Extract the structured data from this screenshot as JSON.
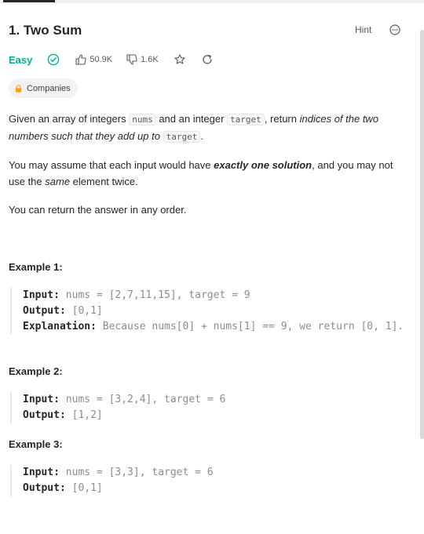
{
  "problem": {
    "title": "1. Two Sum",
    "hint_label": "Hint",
    "difficulty": "Easy",
    "likes": "50.9K",
    "dislikes": "1.6K",
    "companies_label": "Companies"
  },
  "description": {
    "p1": {
      "t1": "Given an array of integers ",
      "code1": "nums",
      "t2": " and an integer ",
      "code2": "target",
      "t3": ", return ",
      "em1": "indices of the two numbers such that they add up to ",
      "code3": "target",
      "t4": "."
    },
    "p2": {
      "t1": "You may assume that each input would have ",
      "strong_em": "exactly one solution",
      "t2": ", and you may not use the ",
      "em": "same",
      "t3": " element twice."
    },
    "p3": "You can return the answer in any order."
  },
  "examples": [
    {
      "title": "Example 1:",
      "input_label": "Input:",
      "input": " nums = [2,7,11,15], target = 9",
      "output_label": "Output:",
      "output": " [0,1]",
      "explanation_label": "Explanation:",
      "explanation": " Because nums[0] + nums[1] == 9, we return [0, 1]."
    },
    {
      "title": "Example 2:",
      "input_label": "Input:",
      "input": " nums = [3,2,4], target = 6",
      "output_label": "Output:",
      "output": " [1,2]"
    },
    {
      "title": "Example 3:",
      "input_label": "Input:",
      "input": " nums = [3,3], target = 6",
      "output_label": "Output:",
      "output": " [0,1]"
    }
  ],
  "colors": {
    "easy": "#00af9b",
    "text": "#262626",
    "muted": "#8c8c8c",
    "lock": "#ffa116"
  },
  "icons": [
    "more-icon",
    "solved-check-icon",
    "thumbs-up-icon",
    "thumbs-down-icon",
    "star-icon",
    "share-icon",
    "lock-icon"
  ]
}
